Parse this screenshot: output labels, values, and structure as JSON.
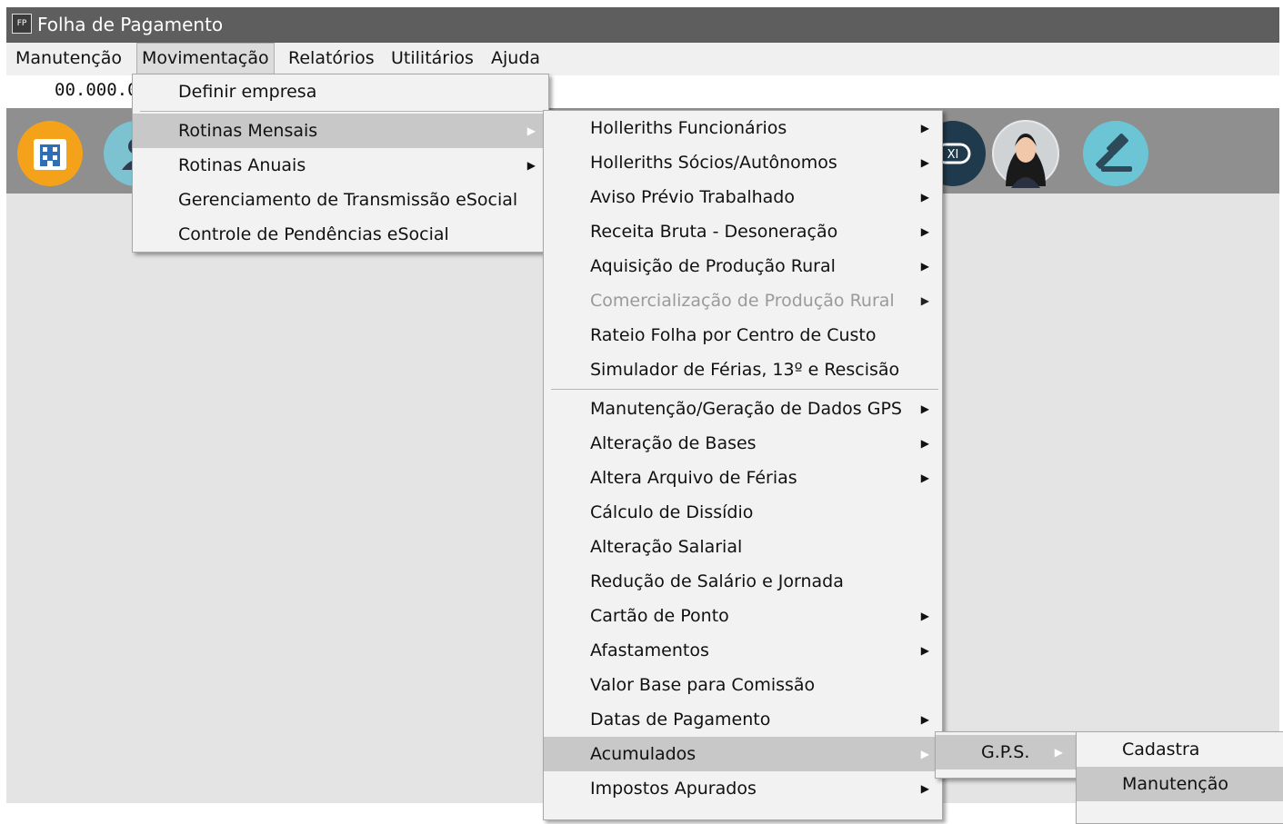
{
  "window": {
    "icon_text": "FP",
    "title": "Folha de Pagamento"
  },
  "menubar": [
    "Manutenção",
    "Movimentação",
    "Relatórios",
    "Utilitários",
    "Ajuda"
  ],
  "info": {
    "company_code": "00.000.0"
  },
  "toolbar": {
    "icons": [
      "company-icon",
      "user-icon",
      "xml-icon",
      "assistant-avatar-icon",
      "legal-gavel-icon"
    ]
  },
  "movimentacao_menu": {
    "items": [
      "Definir empresa",
      "Rotinas Mensais",
      "Rotinas Anuais",
      "Gerenciamento de Transmissão eSocial",
      "Controle de Pendências eSocial"
    ]
  },
  "rotinas_mensais_menu": {
    "items": [
      "Holleriths Funcionários",
      "Holleriths Sócios/Autônomos",
      "Aviso Prévio Trabalhado",
      "Receita Bruta - Desoneração",
      "Aquisição de Produção Rural",
      "Comercialização de Produção Rural",
      "Rateio Folha por Centro de Custo",
      "Simulador de Férias, 13º e Rescisão",
      "Manutenção/Geração de Dados GPS",
      "Alteração de Bases",
      "Altera Arquivo de Férias",
      "Cálculo de Dissídio",
      "Alteração Salarial",
      "Redução de Salário e Jornada",
      "Cartão de Ponto",
      "Afastamentos",
      "Valor Base para Comissão",
      "Datas de Pagamento",
      "Acumulados",
      "Impostos Apurados"
    ]
  },
  "acumulados_menu": {
    "items": [
      "G.P.S."
    ]
  },
  "gps_menu": {
    "items": [
      "Cadastra",
      "Manutenção"
    ]
  },
  "submenu_arrow": "▶"
}
